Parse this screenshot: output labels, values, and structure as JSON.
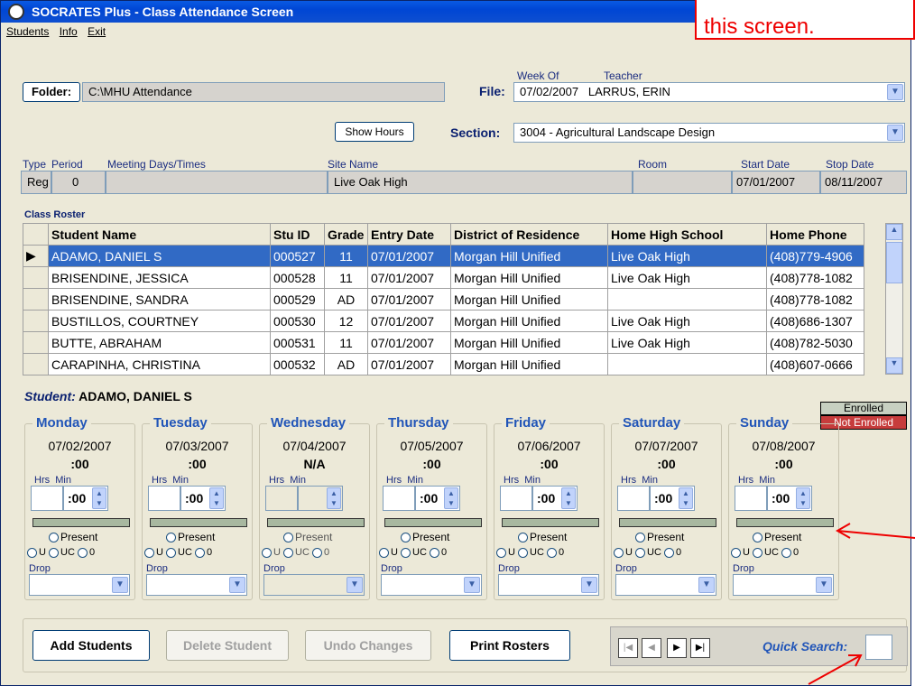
{
  "window": {
    "title": "SOCRATES Plus - Class Attendance Screen"
  },
  "menu": [
    "Students",
    "Info",
    "Exit"
  ],
  "callout": "this screen.",
  "folder": {
    "button": "Folder:",
    "path": "C:\\MHU Attendance"
  },
  "file": {
    "label": "File:",
    "week_of_label": "Week Of",
    "teacher_label": "Teacher",
    "week": "07/02/2007",
    "teacher": "LARRUS, ERIN"
  },
  "show_hours": "Show Hours",
  "section": {
    "label": "Section:",
    "value": "3004 - Agricultural Landscape Design"
  },
  "info": {
    "type_label": "Type",
    "period_label": "Period",
    "meeting_label": "Meeting Days/Times",
    "site_label": "Site Name",
    "room_label": "Room",
    "start_label": "Start Date",
    "stop_label": "Stop Date",
    "type": "Reg",
    "period": "0",
    "site": "Live Oak High",
    "start": "07/01/2007",
    "stop": "08/11/2007"
  },
  "roster": {
    "label": "Class Roster",
    "headers": [
      "Student Name",
      "Stu ID",
      "Grade",
      "Entry Date",
      "District of Residence",
      "Home High School",
      "Home Phone"
    ],
    "rows": [
      [
        "ADAMO, DANIEL S",
        "000527",
        "11",
        "07/01/2007",
        "Morgan Hill Unified",
        "Live Oak High",
        "(408)779-4906"
      ],
      [
        "BRISENDINE, JESSICA",
        "000528",
        "11",
        "07/01/2007",
        "Morgan Hill Unified",
        "Live Oak High",
        "(408)778-1082"
      ],
      [
        "BRISENDINE, SANDRA",
        "000529",
        "AD",
        "07/01/2007",
        "Morgan Hill Unified",
        "",
        "(408)778-1082"
      ],
      [
        "BUSTILLOS, COURTNEY",
        "000530",
        "12",
        "07/01/2007",
        "Morgan Hill Unified",
        "Live Oak High",
        "(408)686-1307"
      ],
      [
        "BUTTE, ABRAHAM",
        "000531",
        "11",
        "07/01/2007",
        "Morgan Hill Unified",
        "Live Oak High",
        "(408)782-5030"
      ],
      [
        "CARAPINHA, CHRISTINA",
        "000532",
        "AD",
        "07/01/2007",
        "Morgan Hill Unified",
        "",
        "(408)607-0666"
      ]
    ]
  },
  "student": {
    "label": "Student:",
    "name": "ADAMO, DANIEL S"
  },
  "legend": {
    "enrolled": "Enrolled",
    "not_enrolled": "Not Enrolled"
  },
  "days": [
    {
      "name": "Monday",
      "date": "07/02/2007",
      "value": ":00"
    },
    {
      "name": "Tuesday",
      "date": "07/03/2007",
      "value": ":00"
    },
    {
      "name": "Wednesday",
      "date": "07/04/2007",
      "value": "N/A"
    },
    {
      "name": "Thursday",
      "date": "07/05/2007",
      "value": ":00"
    },
    {
      "name": "Friday",
      "date": "07/06/2007",
      "value": ":00"
    },
    {
      "name": "Saturday",
      "date": "07/07/2007",
      "value": ":00"
    },
    {
      "name": "Sunday",
      "date": "07/08/2007",
      "value": ":00"
    }
  ],
  "day_labels": {
    "hrs": "Hrs",
    "min": "Min",
    "min_value": ":00",
    "present": "Present",
    "u": "U",
    "uc": "UC",
    "zero": "0",
    "drop": "Drop"
  },
  "buttons": {
    "add": "Add Students",
    "delete": "Delete Student",
    "undo": "Undo Changes",
    "print": "Print Rosters"
  },
  "quick_search": "Quick Search:"
}
